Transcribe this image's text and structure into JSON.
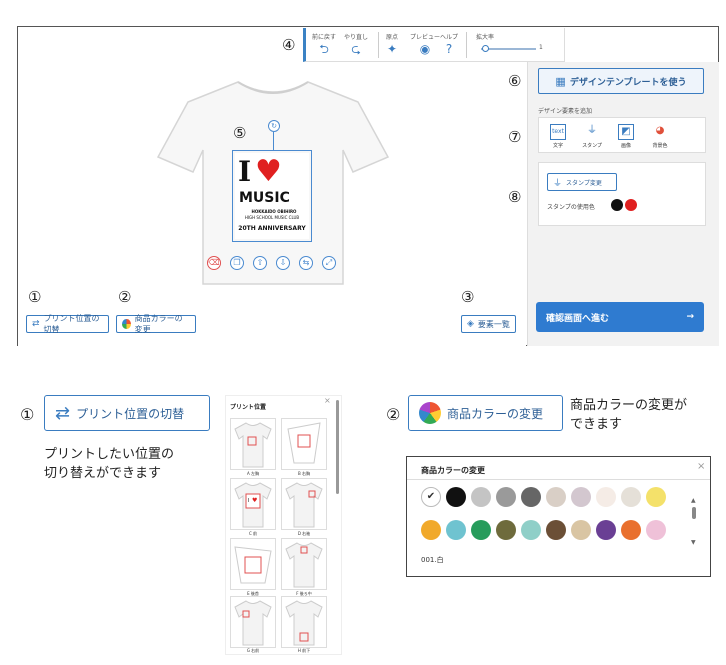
{
  "callouts": {
    "n1": "①",
    "n2": "②",
    "n3": "③",
    "n4": "④",
    "n5": "⑤",
    "n6": "⑥",
    "n7": "⑦",
    "n8": "⑧"
  },
  "toolbar": {
    "undo": "前に戻す",
    "redo": "やり直し",
    "origin": "原点",
    "preview": "プレビュー",
    "help": "ヘルプ",
    "zoom": "拡大率",
    "zoom_value": "1"
  },
  "canvas": {
    "print_switch_label": "プリント位置の切替",
    "product_color_label": "商品カラーの変更",
    "elements_list_label": "要素一覧"
  },
  "design": {
    "line1": "I",
    "line2": "MUSIC",
    "line3": "HOKKAIDO OBIHIRO",
    "line4": "HIGH SCHOOL MUSIC CLUB",
    "line5": "20TH ANNIVERSARY"
  },
  "panel": {
    "template_button": "デザインテンプレートを使う",
    "add_element_title": "デザイン要素を追加",
    "add_text": "文字",
    "add_text_icon": "text",
    "add_stamp": "スタンプ",
    "add_image": "画像",
    "add_colors": "背景色",
    "stamp_change": "スタンプ変更",
    "stamp_colors_label": "スタンプの使用色",
    "stamp_colors": [
      "#111111",
      "#e02020"
    ],
    "confirm_button": "確認画面へ進む",
    "confirm_arrow": "→"
  },
  "explain": {
    "print_button": "プリント位置の切替",
    "print_desc_1": "プリントしたい位置の",
    "print_desc_2": "切り替えができます",
    "color_button": "商品カラーの変更",
    "color_desc_1": "商品カラーの変更が",
    "color_desc_2": "できます"
  },
  "print_positions": {
    "title": "プリント位置",
    "close": "×",
    "items": [
      "A 左胸",
      "B 右胸",
      "C 前",
      "D 右袖",
      "E 後首",
      "F 後ろ中",
      "G 右前",
      "H 前下"
    ]
  },
  "color_dialog": {
    "title": "商品カラーの変更",
    "close": "×",
    "selected_label": "001.白",
    "row1": [
      "#ffffff",
      "#111111",
      "#c4c4c4",
      "#9a9a9a",
      "#666666",
      "#d9cfc6",
      "#d3c7cf",
      "#f5ece6",
      "#e5e0d8",
      "#f4e16a"
    ],
    "row2": [
      "#f1a92a",
      "#6fc3d0",
      "#279c5c",
      "#6e6b3c",
      "#8fcfc8",
      "#6b4f36",
      "#d9c5a3",
      "#6a3f94",
      "#e9702e",
      "#efc1d8"
    ]
  }
}
